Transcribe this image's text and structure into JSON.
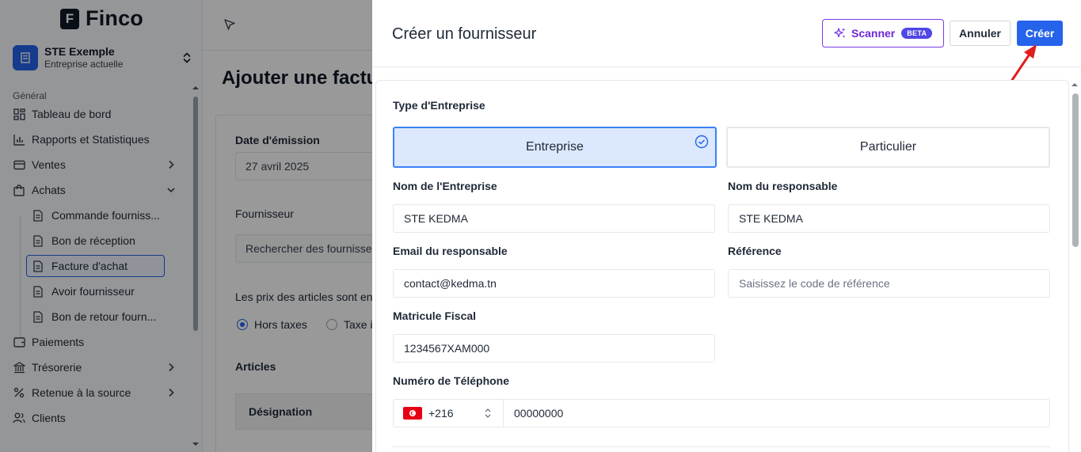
{
  "brand": {
    "logo_letter": "F",
    "name": "Finco"
  },
  "company": {
    "name": "STE Exemple",
    "subtitle": "Entreprise actuelle"
  },
  "sidebar": {
    "section_label": "Général",
    "items": [
      {
        "label": "Tableau de bord"
      },
      {
        "label": "Rapports et Statistiques"
      },
      {
        "label": "Ventes"
      },
      {
        "label": "Achats"
      },
      {
        "label": "Paiements"
      },
      {
        "label": "Trésorerie"
      },
      {
        "label": "Retenue à la source"
      },
      {
        "label": "Clients"
      }
    ],
    "achats_sub": [
      {
        "label": "Commande fourniss..."
      },
      {
        "label": "Bon de réception"
      },
      {
        "label": "Facture d'achat"
      },
      {
        "label": "Avoir fournisseur"
      },
      {
        "label": "Bon de retour fourn..."
      }
    ]
  },
  "page": {
    "title": "Ajouter une factu",
    "date_label": "Date d'émission",
    "date_value": "27 avril 2025",
    "supplier_label": "Fournisseur",
    "supplier_placeholder": "Rechercher des fournisseur",
    "prices_label": "Les prix des articles sont en",
    "radio_ht": "Hors taxes",
    "radio_ttc": "Taxe i",
    "articles_label": "Articles",
    "col_designation": "Désignation"
  },
  "drawer": {
    "title": "Créer un fournisseur",
    "scanner_label": "Scanner",
    "beta_label": "BETA",
    "cancel_label": "Annuler",
    "create_label": "Créer",
    "type_label": "Type d'Entreprise",
    "type_options": [
      "Entreprise",
      "Particulier"
    ],
    "selected_type": "Entreprise",
    "company_name_label": "Nom de l'Entreprise",
    "company_name_value": "STE KEDMA",
    "manager_name_label": "Nom du responsable",
    "manager_name_value": "STE KEDMA",
    "email_label": "Email du responsable",
    "email_value": "contact@kedma.tn",
    "reference_label": "Référence",
    "reference_placeholder": "Saisissez le code de référence",
    "tax_id_label": "Matricule Fiscal",
    "tax_id_value": "1234567XAM000",
    "phone_label": "Numéro de Téléphone",
    "phone_code": "+216",
    "phone_value": "00000000"
  },
  "colors": {
    "primary": "#2563eb",
    "scanner": "#7c3aed",
    "annotation_arrow": "#e11d1d",
    "selected_bg": "#dbe8fd"
  }
}
